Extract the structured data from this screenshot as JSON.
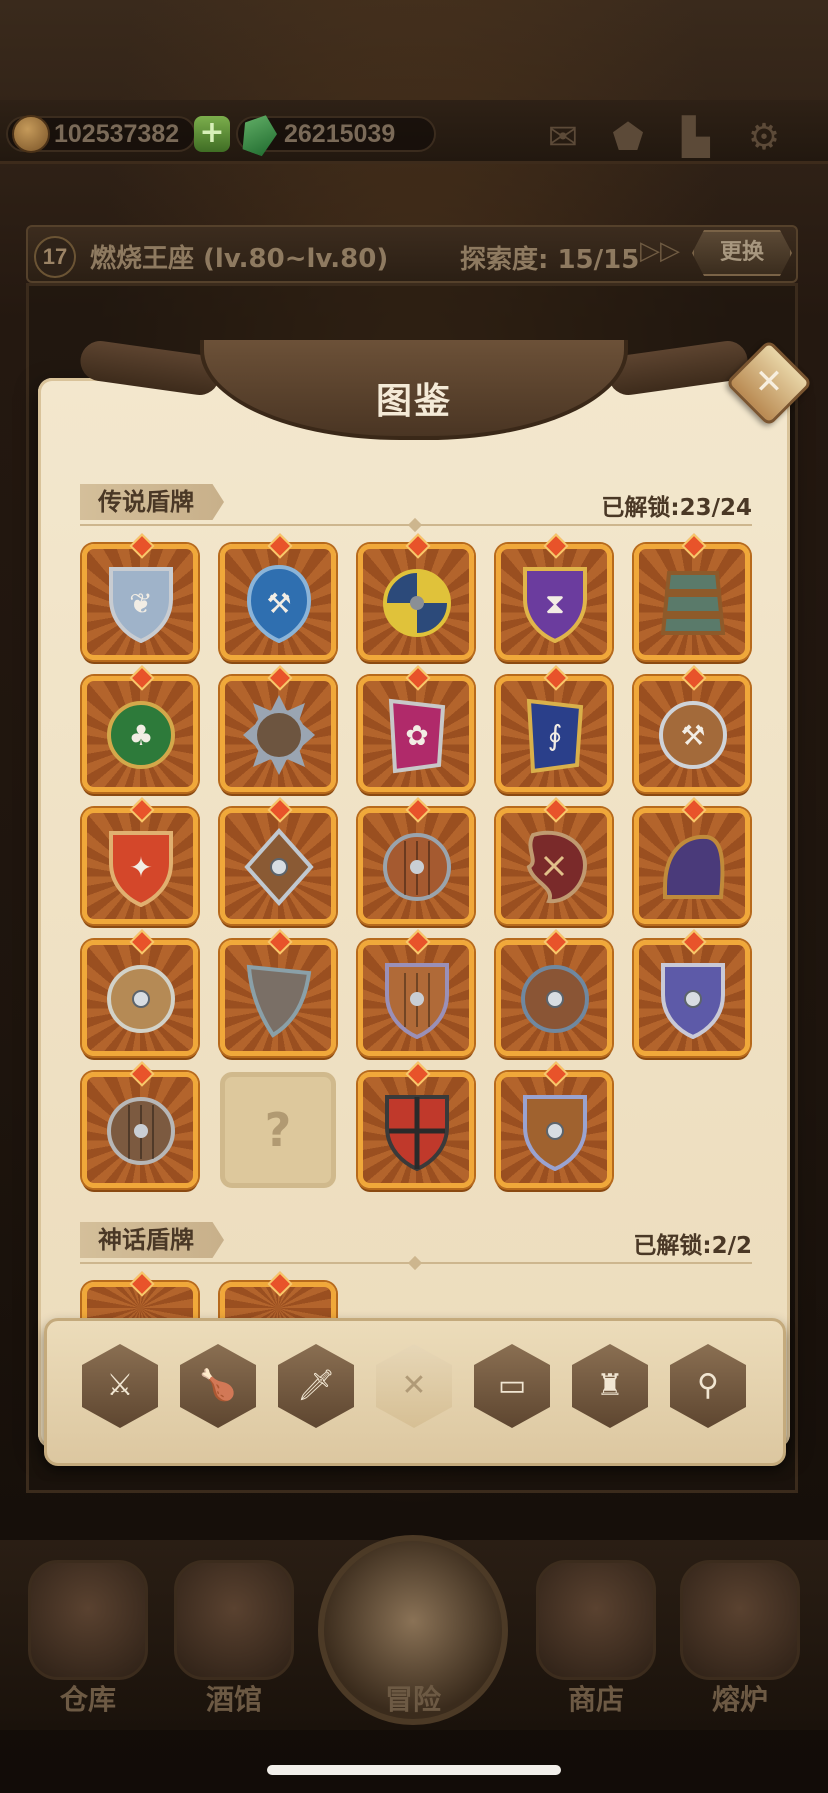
{
  "top_bar": {
    "gold": "102537382",
    "gems": "26215039",
    "icons": [
      "mail-icon",
      "badge-icon",
      "book-icon",
      "gear-icon"
    ]
  },
  "zone": {
    "level": "17",
    "name": "燃烧王座 (lv.80~lv.80)",
    "explore": "探索度: 15/15",
    "change_label": "更换"
  },
  "modal": {
    "title": "图鉴",
    "legend_section": {
      "label": "传说盾牌",
      "unlocked": "已解锁:23/24"
    },
    "myth_section": {
      "label": "神话盾牌",
      "unlocked": "已解锁:2/2"
    },
    "locked_mark": "?"
  },
  "shields": [
    {
      "shape": "heater",
      "color": "#9fb3c9",
      "trim": "#c8ccd1",
      "emblem": "stag"
    },
    {
      "shape": "kite-round",
      "color": "#2f6fb0",
      "trim": "#8bb4d8",
      "emblem": "axe"
    },
    {
      "shape": "round",
      "color": "#2c4a7a",
      "trim": "#e0c23a",
      "emblem": "segments"
    },
    {
      "shape": "heater",
      "color": "#6b3c9e",
      "trim": "#e0b54a",
      "emblem": "hourglass"
    },
    {
      "shape": "barrel",
      "color": "#5a7a6a",
      "trim": "#8e5a2a",
      "emblem": "bands"
    },
    {
      "shape": "round",
      "color": "#2d7a3a",
      "trim": "#d4a84a",
      "emblem": "clover"
    },
    {
      "shape": "spiked",
      "color": "#6d5540",
      "trim": "#9aa5b2",
      "emblem": "stone"
    },
    {
      "shape": "banner",
      "color": "#b02a6a",
      "trim": "#c8c8c8",
      "emblem": "flower"
    },
    {
      "shape": "banner",
      "color": "#2a3f8a",
      "trim": "#d9b04a",
      "emblem": "seahorse"
    },
    {
      "shape": "round",
      "color": "#a36a3a",
      "trim": "#cfd3d8",
      "emblem": "axe"
    },
    {
      "shape": "heater",
      "color": "#d4472a",
      "trim": "#e0b070",
      "emblem": "wolf"
    },
    {
      "shape": "diamond",
      "color": "#8a5a34",
      "trim": "#c0c8d0",
      "emblem": "stud"
    },
    {
      "shape": "round",
      "color": "#a55a30",
      "trim": "#9aa4ad",
      "emblem": "planks"
    },
    {
      "shape": "tear",
      "color": "#7a2a2a",
      "trim": "#c09a70",
      "emblem": "cross"
    },
    {
      "shape": "dome",
      "color": "#4a3a7a",
      "trim": "#c08a3a",
      "emblem": "plain"
    },
    {
      "shape": "round",
      "color": "#b58a55",
      "trim": "#d2d2c8",
      "emblem": "boss"
    },
    {
      "shape": "triangle",
      "color": "#7a6f66",
      "trim": "#8aa0a8",
      "emblem": "plain"
    },
    {
      "shape": "heater",
      "color": "#b06a38",
      "trim": "#9a90b8",
      "emblem": "planks"
    },
    {
      "shape": "round",
      "color": "#8a5535",
      "trim": "#6f88a0",
      "emblem": "boss"
    },
    {
      "shape": "heater",
      "color": "#5d5aa8",
      "trim": "#c9c9d6",
      "emblem": "boss"
    },
    {
      "shape": "round",
      "color": "#7c5a40",
      "trim": "#b7b7b7",
      "emblem": "planks"
    },
    {
      "shape": "locked"
    },
    {
      "shape": "heater",
      "color": "#c0392b",
      "trim": "#3a3a3a",
      "emblem": "quarters"
    },
    {
      "shape": "heater",
      "color": "#a0622f",
      "trim": "#9aa3d0",
      "emblem": "boss"
    }
  ],
  "tabs": [
    {
      "icon": "armor-icon",
      "glyph": "⚔"
    },
    {
      "icon": "drumstick-icon",
      "glyph": "🍗"
    },
    {
      "icon": "sword-icon",
      "glyph": "🗡"
    },
    {
      "icon": "shield-tab-icon",
      "glyph": "✕"
    },
    {
      "icon": "book-tab-icon",
      "glyph": "▭"
    },
    {
      "icon": "helmet-icon",
      "glyph": "♜"
    },
    {
      "icon": "ring-icon",
      "glyph": "⚲"
    }
  ],
  "bottom_nav": [
    {
      "label": "仓库"
    },
    {
      "label": "酒馆"
    },
    {
      "label": "冒险"
    },
    {
      "label": "商店"
    },
    {
      "label": "熔炉"
    }
  ]
}
